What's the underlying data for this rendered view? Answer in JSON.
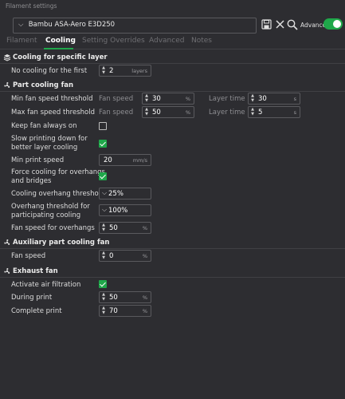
{
  "window": {
    "title": "Filament settings"
  },
  "preset": {
    "name": "Bambu ASA-Aero E3D250",
    "advanced_label": "Advanced",
    "advanced_on": true
  },
  "tabs": [
    {
      "label": "Filament",
      "active": false
    },
    {
      "label": "Cooling",
      "active": true
    },
    {
      "label": "Setting Overrides",
      "active": false
    },
    {
      "label": "Advanced",
      "active": false
    },
    {
      "label": "Notes",
      "active": false
    }
  ],
  "sections": {
    "layer": {
      "title": "Cooling for specific layer",
      "no_cooling_first": {
        "label": "No cooling for the first",
        "value": "2",
        "unit": "layers"
      }
    },
    "part_fan": {
      "title": "Part cooling fan",
      "min_fan": {
        "label": "Min fan speed threshold",
        "fan_speed_label": "Fan speed",
        "fan_speed": "30",
        "fan_unit": "%",
        "layer_time_label": "Layer time",
        "layer_time": "30",
        "layer_unit": "s"
      },
      "max_fan": {
        "label": "Max fan speed threshold",
        "fan_speed_label": "Fan speed",
        "fan_speed": "50",
        "fan_unit": "%",
        "layer_time_label": "Layer time",
        "layer_time": "5",
        "layer_unit": "s"
      },
      "keep_fan_on": {
        "label": "Keep fan always on",
        "checked": false
      },
      "slow_down": {
        "label_line1": "Slow printing down for",
        "label_line2": "better layer cooling",
        "checked": true
      },
      "min_print_speed": {
        "label": "Min print speed",
        "value": "20",
        "unit": "mm/s"
      },
      "force_cooling": {
        "label_line1": "Force cooling for overhangs",
        "label_line2": "and bridges",
        "checked": true
      },
      "overhang_threshold": {
        "label": "Cooling overhang threshold",
        "value": "25%"
      },
      "overhang_participating": {
        "label_line1": "Overhang threshold for",
        "label_line2": "participating cooling",
        "value": "100%"
      },
      "overhang_fan_speed": {
        "label": "Fan speed for overhangs",
        "value": "50",
        "unit": "%"
      }
    },
    "aux_fan": {
      "title": "Auxiliary part cooling fan",
      "fan_speed": {
        "label": "Fan speed",
        "value": "0",
        "unit": "%"
      }
    },
    "exhaust": {
      "title": "Exhaust fan",
      "activate_filtration": {
        "label": "Activate air filtration",
        "checked": true
      },
      "during_print": {
        "label": "During print",
        "value": "50",
        "unit": "%"
      },
      "complete_print": {
        "label": "Complete print",
        "value": "70",
        "unit": "%"
      }
    }
  },
  "colors": {
    "background": "#2d2d31",
    "accent": "#1fa84a",
    "border": "#5a5a5e",
    "muted_text": "#8e8e92"
  },
  "icons": [
    "chevron-down-icon",
    "save-icon",
    "close-icon",
    "search-icon",
    "layers-icon",
    "fan-icon"
  ]
}
